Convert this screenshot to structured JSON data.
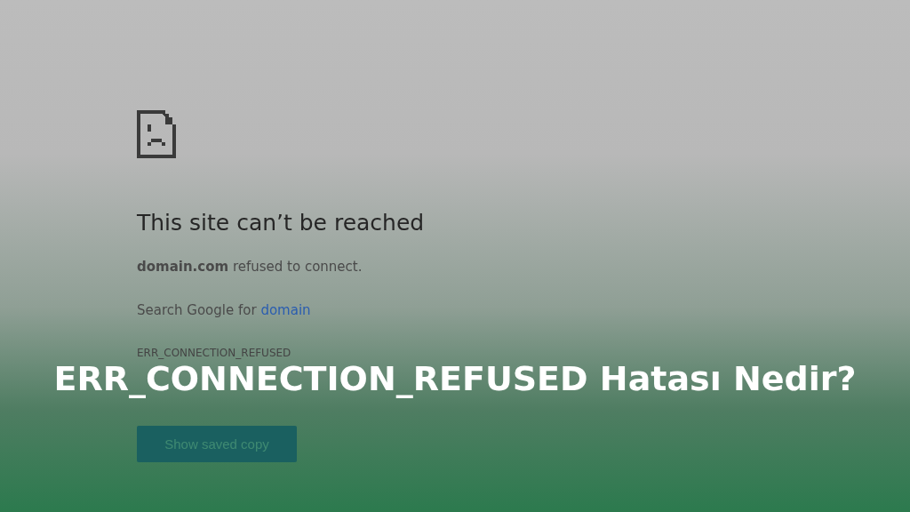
{
  "error_page": {
    "heading": "This site can’t be reached",
    "message": "**domain.com** refused to connect.",
    "search_prefix": "Search Google for",
    "search_link": "domain",
    "error_code": "ERR_CONNECTION_REFUSED",
    "button": "Show saved copy"
  },
  "banner": {
    "title": "ERR_CONNECTION_REFUSED Hatası Nedir?"
  }
}
